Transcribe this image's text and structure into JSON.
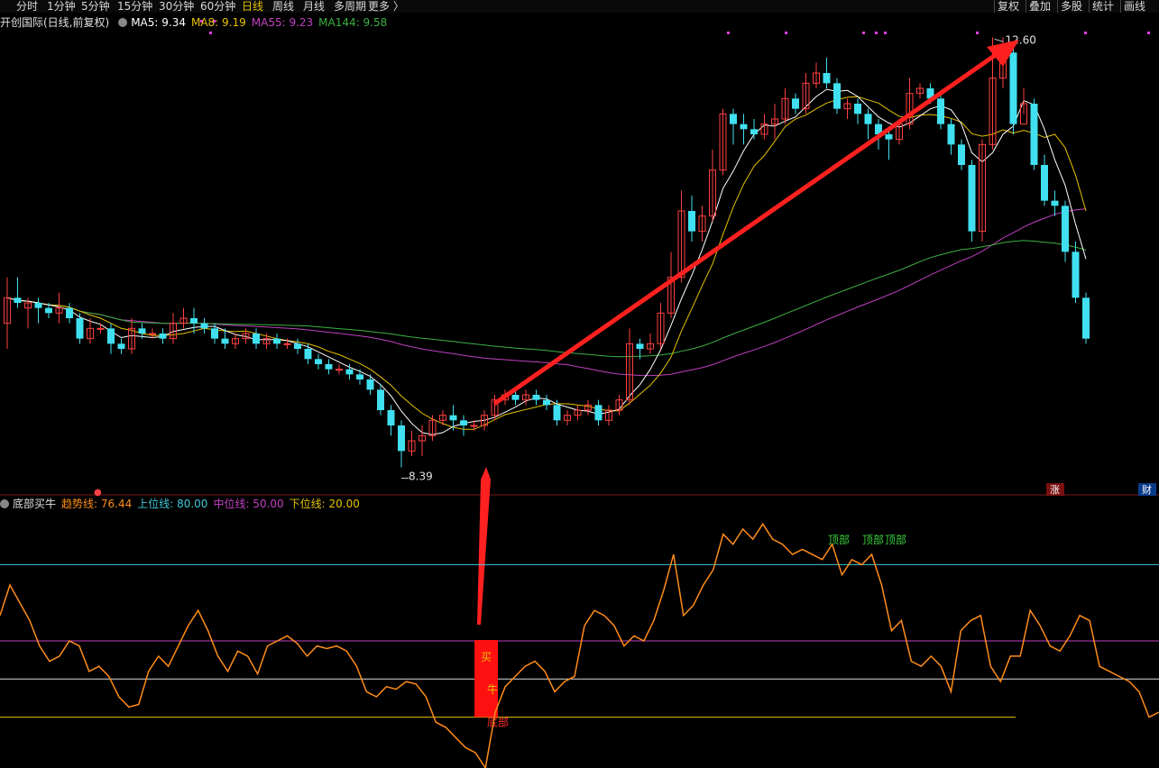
{
  "toolbar": {
    "periods": [
      "分时",
      "1分钟",
      "5分钟",
      "15分钟",
      "30分钟",
      "60分钟",
      "日线",
      "周线",
      "月线",
      "多周期",
      "更多 〉"
    ],
    "active_period": "日线",
    "right_buttons": [
      "复权",
      "叠加",
      "多股",
      "统计",
      "画线"
    ]
  },
  "main_legend": {
    "title": "开创国际(日线,前复权)",
    "items": [
      {
        "label": "MA5: 9.34",
        "color": "#ffffff"
      },
      {
        "label": "MA8: 9.19",
        "color": "#e6c200"
      },
      {
        "label": "MA55: 9.23",
        "color": "#c040c0"
      },
      {
        "label": "MA144: 9.58",
        "color": "#3cb043"
      }
    ]
  },
  "indicator_legend": {
    "title": "底部买牛",
    "items": [
      {
        "label": "趋势线: 76.44",
        "color": "#ff8c1a"
      },
      {
        "label": "上位线: 80.00",
        "color": "#3cc8d8"
      },
      {
        "label": "中位线: 50.00",
        "color": "#c040c0"
      },
      {
        "label": "下位线: 20.00",
        "color": "#e6c200"
      }
    ]
  },
  "annotations": {
    "high_label": "12.60",
    "low_label": "8.39",
    "top_labels": [
      "顶部",
      "顶部",
      "顶部"
    ],
    "buy_text": [
      "买",
      "牛"
    ],
    "bottom_label": "底部",
    "rise_badge": "涨",
    "fin_badge": "财"
  },
  "colors": {
    "up": "#ff4040",
    "down": "#40e0f0",
    "background": "#000000",
    "arrow": "#ff2020"
  },
  "chart_data": [
    {
      "type": "candlestick",
      "price_range": [
        8.2,
        12.7
      ],
      "candles": [
        [
          9.8,
          10.05,
          10.25,
          9.55
        ],
        [
          10.05,
          10.0,
          10.25,
          9.95
        ],
        [
          9.95,
          10.0,
          10.05,
          9.75
        ],
        [
          10.0,
          9.95,
          10.05,
          9.8
        ],
        [
          9.95,
          9.9,
          10.0,
          9.85
        ],
        [
          9.9,
          9.95,
          10.1,
          9.8
        ],
        [
          9.95,
          9.85,
          10.0,
          9.8
        ],
        [
          9.85,
          9.65,
          9.9,
          9.6
        ],
        [
          9.65,
          9.75,
          9.85,
          9.6
        ],
        [
          9.75,
          9.75,
          9.8,
          9.7
        ],
        [
          9.75,
          9.6,
          9.8,
          9.5
        ],
        [
          9.6,
          9.55,
          9.65,
          9.5
        ],
        [
          9.55,
          9.75,
          9.85,
          9.5
        ],
        [
          9.75,
          9.7,
          9.8,
          9.65
        ],
        [
          9.7,
          9.7,
          9.75,
          9.65
        ],
        [
          9.7,
          9.65,
          9.75,
          9.6
        ],
        [
          9.65,
          9.8,
          9.9,
          9.6
        ],
        [
          9.8,
          9.85,
          9.95,
          9.75
        ],
        [
          9.85,
          9.8,
          9.95,
          9.7
        ],
        [
          9.8,
          9.75,
          9.85,
          9.7
        ],
        [
          9.75,
          9.65,
          9.8,
          9.6
        ],
        [
          9.65,
          9.6,
          9.75,
          9.55
        ],
        [
          9.6,
          9.65,
          9.7,
          9.55
        ],
        [
          9.65,
          9.7,
          9.75,
          9.6
        ],
        [
          9.7,
          9.6,
          9.75,
          9.55
        ],
        [
          9.6,
          9.65,
          9.7,
          9.55
        ],
        [
          9.65,
          9.6,
          9.7,
          9.55
        ],
        [
          9.6,
          9.6,
          9.65,
          9.55
        ],
        [
          9.6,
          9.55,
          9.65,
          9.5
        ],
        [
          9.55,
          9.45,
          9.6,
          9.4
        ],
        [
          9.45,
          9.4,
          9.5,
          9.35
        ],
        [
          9.4,
          9.35,
          9.45,
          9.3
        ],
        [
          9.35,
          9.35,
          9.4,
          9.3
        ],
        [
          9.35,
          9.3,
          9.4,
          9.25
        ],
        [
          9.3,
          9.25,
          9.35,
          9.2
        ],
        [
          9.25,
          9.15,
          9.3,
          9.1
        ],
        [
          9.15,
          8.95,
          9.2,
          8.9
        ],
        [
          8.95,
          8.8,
          9.0,
          8.7
        ],
        [
          8.8,
          8.55,
          8.85,
          8.39
        ],
        [
          8.55,
          8.65,
          8.75,
          8.5
        ],
        [
          8.65,
          8.7,
          8.8,
          8.5
        ],
        [
          8.7,
          8.85,
          8.9,
          8.65
        ],
        [
          8.85,
          8.9,
          8.95,
          8.8
        ],
        [
          8.9,
          8.85,
          9.0,
          8.75
        ],
        [
          8.85,
          8.8,
          8.9,
          8.7
        ],
        [
          8.8,
          8.8,
          8.85,
          8.75
        ],
        [
          8.8,
          8.9,
          8.95,
          8.75
        ],
        [
          8.9,
          9.05,
          9.1,
          8.85
        ],
        [
          9.05,
          9.1,
          9.15,
          9.0
        ],
        [
          9.1,
          9.05,
          9.15,
          9.0
        ],
        [
          9.05,
          9.1,
          9.15,
          9.0
        ],
        [
          9.1,
          9.05,
          9.15,
          9.0
        ],
        [
          9.05,
          9.0,
          9.1,
          8.95
        ],
        [
          9.0,
          8.85,
          9.05,
          8.8
        ],
        [
          8.85,
          8.9,
          8.95,
          8.8
        ],
        [
          8.9,
          8.95,
          9.0,
          8.85
        ],
        [
          8.95,
          9.0,
          9.05,
          8.9
        ],
        [
          9.0,
          8.85,
          9.05,
          8.8
        ],
        [
          8.85,
          8.95,
          9.0,
          8.8
        ],
        [
          8.95,
          9.05,
          9.1,
          8.9
        ],
        [
          9.05,
          9.6,
          9.75,
          9.0
        ],
        [
          9.6,
          9.55,
          9.65,
          9.45
        ],
        [
          9.55,
          9.6,
          9.7,
          9.5
        ],
        [
          9.6,
          9.9,
          10.0,
          9.55
        ],
        [
          9.9,
          10.25,
          10.5,
          9.85
        ],
        [
          10.25,
          10.9,
          11.1,
          10.2
        ],
        [
          10.9,
          10.7,
          11.05,
          10.6
        ],
        [
          10.7,
          10.85,
          10.95,
          10.6
        ],
        [
          10.85,
          11.3,
          11.5,
          10.8
        ],
        [
          11.3,
          11.85,
          11.9,
          11.25
        ],
        [
          11.85,
          11.75,
          11.9,
          11.55
        ],
        [
          11.75,
          11.7,
          11.85,
          11.55
        ],
        [
          11.7,
          11.65,
          11.8,
          11.6
        ],
        [
          11.65,
          11.75,
          11.85,
          11.6
        ],
        [
          11.75,
          11.8,
          11.95,
          11.6
        ],
        [
          11.8,
          12.0,
          12.1,
          11.75
        ],
        [
          12.0,
          11.9,
          12.05,
          11.85
        ],
        [
          11.9,
          12.15,
          12.25,
          11.85
        ],
        [
          12.15,
          12.25,
          12.35,
          12.1
        ],
        [
          12.25,
          12.15,
          12.4,
          12.1
        ],
        [
          12.15,
          11.9,
          12.2,
          11.85
        ],
        [
          11.9,
          11.95,
          12.0,
          11.8
        ],
        [
          11.95,
          11.85,
          12.0,
          11.75
        ],
        [
          11.85,
          11.75,
          11.9,
          11.6
        ],
        [
          11.75,
          11.65,
          11.8,
          11.5
        ],
        [
          11.65,
          11.6,
          11.7,
          11.4
        ],
        [
          11.6,
          11.75,
          11.8,
          11.55
        ],
        [
          11.75,
          12.05,
          12.2,
          11.7
        ],
        [
          12.05,
          12.1,
          12.15,
          12.0
        ],
        [
          12.1,
          12.0,
          12.15,
          11.95
        ],
        [
          12.0,
          11.75,
          12.05,
          11.7
        ],
        [
          11.75,
          11.55,
          11.8,
          11.45
        ],
        [
          11.55,
          11.35,
          11.6,
          11.3
        ],
        [
          11.35,
          10.7,
          11.4,
          10.6
        ],
        [
          10.7,
          11.55,
          11.6,
          10.6
        ],
        [
          11.55,
          12.2,
          12.6,
          11.5
        ],
        [
          12.2,
          12.45,
          12.6,
          12.1
        ],
        [
          12.45,
          11.75,
          12.5,
          11.65
        ],
        [
          11.75,
          11.95,
          12.1,
          11.85
        ],
        [
          11.95,
          11.35,
          12.0,
          11.3
        ],
        [
          11.35,
          11.0,
          11.45,
          10.95
        ],
        [
          11.0,
          10.95,
          11.1,
          10.85
        ],
        [
          10.95,
          10.5,
          11.0,
          10.4
        ],
        [
          10.5,
          10.05,
          10.6,
          10.0
        ],
        [
          10.05,
          9.65,
          10.1,
          9.6
        ]
      ]
    },
    {
      "type": "line",
      "name": "趋势线",
      "y_range": [
        0,
        100
      ],
      "reference_lines": [
        80,
        50,
        20
      ],
      "values": [
        60,
        72,
        65,
        58,
        48,
        42,
        44,
        50,
        48,
        38,
        40,
        36,
        28,
        24,
        25,
        38,
        44,
        40,
        48,
        56,
        62,
        54,
        44,
        38,
        46,
        44,
        37,
        48,
        50,
        52,
        49,
        44,
        48,
        47,
        48,
        46,
        40,
        30,
        28,
        32,
        31,
        34,
        33,
        28,
        18,
        16,
        12,
        8,
        6,
        0,
        22,
        32,
        36,
        40,
        42,
        38,
        30,
        34,
        36,
        56,
        62,
        60,
        56,
        48,
        52,
        50,
        58,
        70,
        84,
        60,
        64,
        72,
        78,
        92,
        88,
        94,
        90,
        96,
        90,
        88,
        84,
        86,
        84,
        82,
        88,
        76,
        82,
        80,
        84,
        72,
        54,
        58,
        42,
        40,
        44,
        40,
        30,
        54,
        58,
        60,
        40,
        34,
        44,
        44,
        62,
        56,
        48,
        46,
        52,
        60,
        58,
        40,
        38,
        36,
        34,
        30,
        20,
        22
      ],
      "signals": {
        "buy_zone_index": 52,
        "top_indices": [
          88,
          91,
          93
        ]
      }
    }
  ]
}
